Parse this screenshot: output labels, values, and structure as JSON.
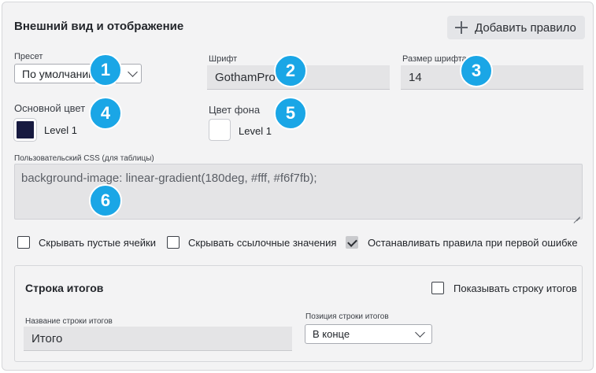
{
  "header": {
    "title": "Внешний вид и отображение",
    "add_rule_label": "Добавить правило"
  },
  "preset": {
    "label": "Пресет",
    "value": "По умолчанию"
  },
  "font": {
    "label": "Шрифт",
    "value": "GothamPro"
  },
  "font_size": {
    "label": "Размер шрифта",
    "value": "14"
  },
  "primary_color": {
    "label": "Основной цвет",
    "value": "Level 1",
    "swatch": "#171a40"
  },
  "background_color": {
    "label": "Цвет фона",
    "value": "Level 1",
    "swatch": "#ffffff"
  },
  "custom_css": {
    "label": "Пользовательский CSS (для таблицы)",
    "value": "background-image: linear-gradient(180deg, #fff, #f6f7fb);"
  },
  "options": [
    {
      "label": "Скрывать пустые ячейки",
      "checked": false
    },
    {
      "label": "Скрывать ссылочные значения",
      "checked": false
    },
    {
      "label": "Останавливать правила при первой ошибке",
      "checked": true
    }
  ],
  "totals": {
    "title": "Строка итогов",
    "show_label": "Показывать строку итогов",
    "show_checked": false,
    "name_label": "Название строки итогов",
    "name_value": "Итого",
    "position_label": "Позиция строки итогов",
    "position_value": "В конце"
  },
  "badges": [
    "1",
    "2",
    "3",
    "4",
    "5",
    "6"
  ],
  "accent_color": "#1aa6e6"
}
